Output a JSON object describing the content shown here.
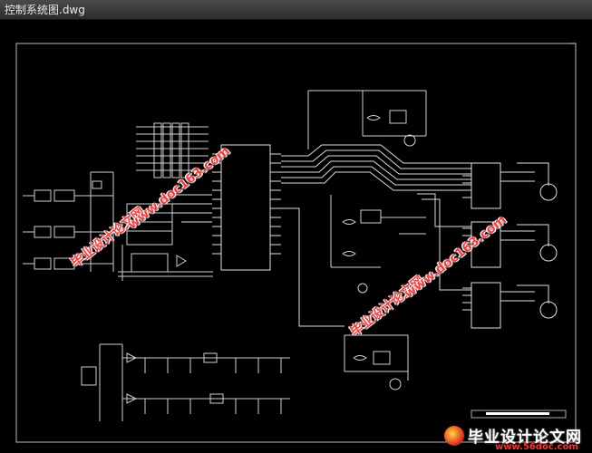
{
  "window": {
    "title": "控制系统图.dwg"
  },
  "watermarks": {
    "brand": "毕业设计论文网",
    "url": "www.doc163.com"
  },
  "footer": {
    "brand": "毕业设计论文网",
    "url": "www.56doc.com"
  }
}
